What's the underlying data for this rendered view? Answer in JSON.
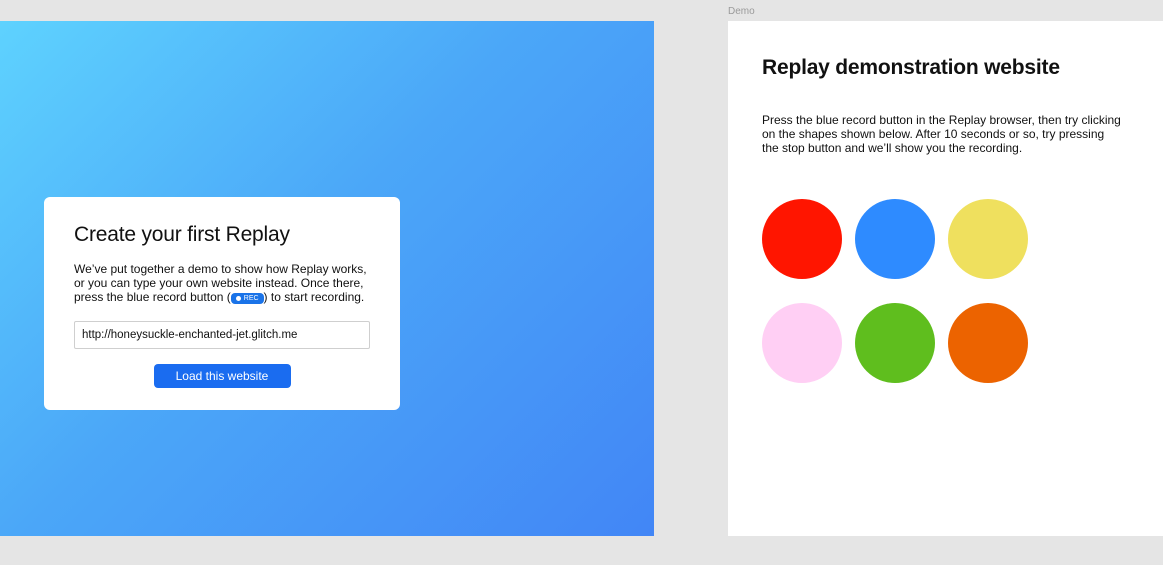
{
  "canvas": {
    "frame_label": "Demo"
  },
  "onboarding_card": {
    "title": "Create your first Replay",
    "description_before": "We’ve put together a demo to show how Replay works, or you can type your own website instead. Once there, press the blue record button (",
    "rec_label": "REC",
    "description_after": ") to start recording.",
    "url_value": "http://honeysuckle-enchanted-jet.glitch.me",
    "load_button_label": "Load this website"
  },
  "demo_site": {
    "title": "Replay demonstration website",
    "description": "Press the blue record button in the Replay browser, then try clicking on the shapes shown below. After 10 seconds or so, try pressing the stop button and we’ll show you the recording.",
    "shapes": [
      {
        "name": "red-circle",
        "color": "#ff1500"
      },
      {
        "name": "blue-circle",
        "color": "#2e8bff"
      },
      {
        "name": "yellow-circle",
        "color": "#efe05e"
      },
      {
        "name": "pink-circle",
        "color": "#ffcff4"
      },
      {
        "name": "green-circle",
        "color": "#5fbe1e"
      },
      {
        "name": "orange-circle",
        "color": "#ec6300"
      }
    ]
  },
  "colors": {
    "accent_blue": "#1a6cf0",
    "gradient_start": "#5ed2fe",
    "gradient_end": "#4286f6"
  }
}
